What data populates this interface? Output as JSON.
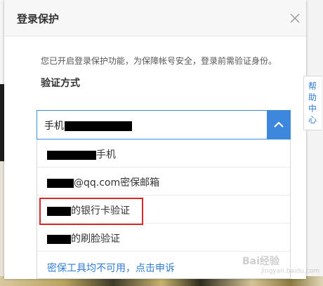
{
  "dialog": {
    "title": "登录保护",
    "description": "您已开启登录保护功能，为保障帐号安全，登录前需验证身份。",
    "section_title": "验证方式"
  },
  "select": {
    "value_prefix": "手机"
  },
  "options": [
    {
      "suffix": "手机"
    },
    {
      "suffix": "@qq.com密保邮箱"
    },
    {
      "suffix": "的银行卡验证"
    },
    {
      "suffix": "的刷脸验证"
    }
  ],
  "link": {
    "label": "密保工具均不可用，点击申诉"
  },
  "help_tab": {
    "label": "帮助中心"
  },
  "watermark": {
    "text": "Bai经验",
    "sub": "jingyan.baidu.com"
  },
  "colors": {
    "accent": "#3d87dc",
    "link": "#2f7cd3",
    "highlight": "#d42a2a"
  }
}
